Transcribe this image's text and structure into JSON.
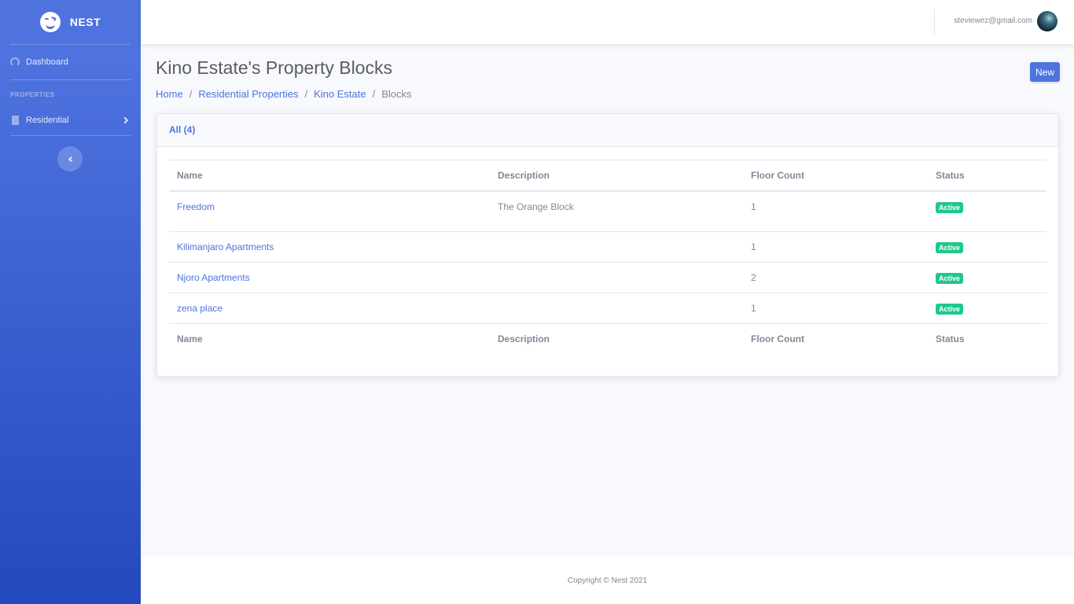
{
  "sidebar": {
    "brand": "NEST",
    "dashboard_label": "Dashboard",
    "section_heading": "PROPERTIES",
    "residential_label": "Residential"
  },
  "topbar": {
    "user_email": "steviewez@gmail.com"
  },
  "page": {
    "title": "Kino Estate's Property Blocks",
    "new_button": "New",
    "breadcrumb": [
      "Home",
      "Residential Properties",
      "Kino Estate",
      "Blocks"
    ]
  },
  "card": {
    "tab_label": "All (4)",
    "columns": [
      "Name",
      "Description",
      "Floor Count",
      "Status"
    ],
    "rows": [
      {
        "name": "Freedom",
        "description": "The Orange Block",
        "floor_count": "1",
        "status": "Active"
      },
      {
        "name": "Kilimanjaro Apartments",
        "description": "",
        "floor_count": "1",
        "status": "Active"
      },
      {
        "name": "Njoro Apartments",
        "description": "",
        "floor_count": "2",
        "status": "Active"
      },
      {
        "name": "zena place",
        "description": "",
        "floor_count": "1",
        "status": "Active"
      }
    ]
  },
  "footer": {
    "copyright": "Copyright © Nest 2021"
  },
  "colors": {
    "primary": "#4e73df",
    "success": "#1cc88a",
    "text": "#858796"
  }
}
